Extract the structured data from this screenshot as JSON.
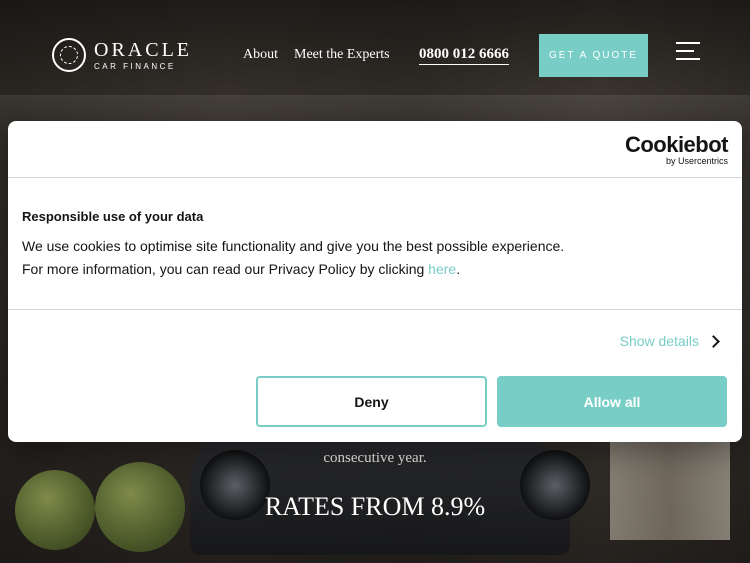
{
  "header": {
    "logo_main": "ORACLE",
    "logo_sub": "CAR FINANCE",
    "nav": [
      "About",
      "Meet the Experts"
    ],
    "phone": "0800 012 6666",
    "quote_label": "GET A QUOTE"
  },
  "hero": {
    "subtext": "consecutive year.",
    "rate": "RATES FROM 8.9%"
  },
  "cookie_dialog": {
    "brand": "Cookiebot",
    "brand_sub": "by Usercentrics",
    "title": "Responsible use of your data",
    "line1": "We use cookies to optimise site functionality and give you the best possible experience.",
    "line2_prefix": "For more information, you can read our Privacy Policy by clicking ",
    "line2_link": "here",
    "line2_suffix": ".",
    "show_details": "Show details",
    "deny": "Deny",
    "allow": "Allow all"
  },
  "colors": {
    "accent": "#78cdc6",
    "text": "#141414"
  }
}
